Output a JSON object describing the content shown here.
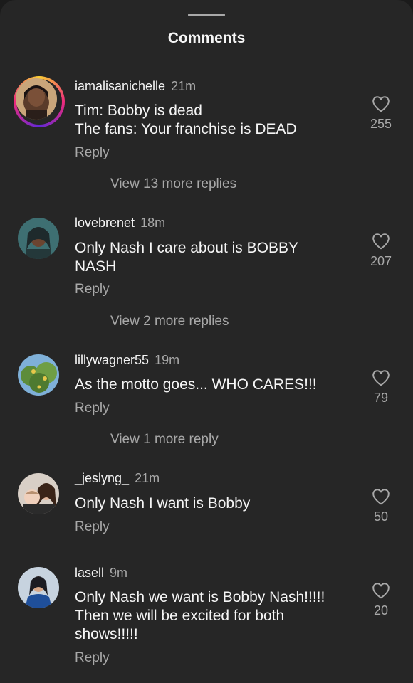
{
  "sheet": {
    "title": "Comments"
  },
  "comments": [
    {
      "username": "iamalisanichelle",
      "time": "21m",
      "line1": "Tim: Bobby is dead",
      "line2": "The fans: Your franchise is DEAD",
      "reply": "Reply",
      "likes": "255",
      "view_more": "View 13 more replies"
    },
    {
      "username": "lovebrenet",
      "time": "18m",
      "line1": "Only Nash I care about is BOBBY",
      "line2": "NASH",
      "reply": "Reply",
      "likes": "207",
      "view_more": "View 2 more replies"
    },
    {
      "username": "lillywagner55",
      "time": "19m",
      "line1": "As the motto goes... WHO CARES!!!",
      "reply": "Reply",
      "likes": "79",
      "view_more": "View 1 more reply"
    },
    {
      "username": "_jeslyng_",
      "time": "21m",
      "line1": "Only Nash I want is Bobby",
      "reply": "Reply",
      "likes": "50"
    },
    {
      "username": "lasell",
      "time": "9m",
      "line1": "Only Nash we want is Bobby Nash!!!!!",
      "line2": "Then we will be excited for both",
      "line3": "shows!!!!!",
      "reply": "Reply",
      "likes": "20"
    }
  ],
  "icons": {
    "like": "heart-outline-icon",
    "avatar": "profile-photo"
  },
  "colors": {
    "background": "#262626",
    "primary_text": "#f5f5f5",
    "secondary_text": "#a8a8a8"
  }
}
